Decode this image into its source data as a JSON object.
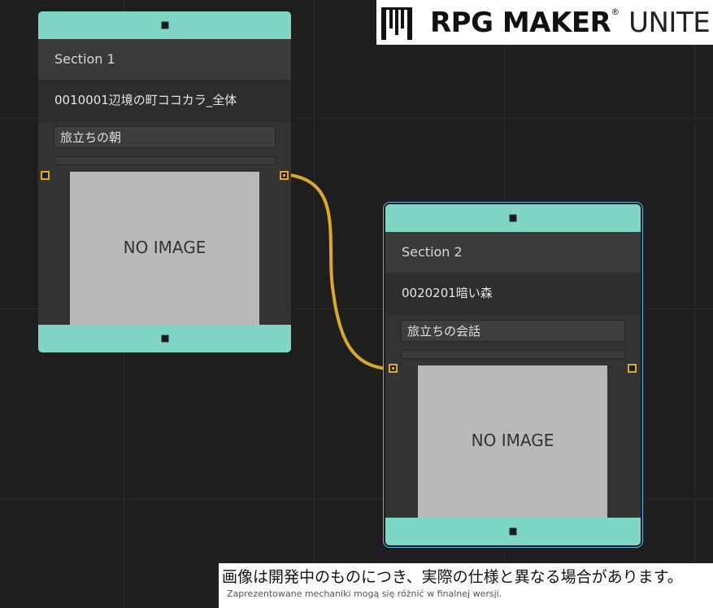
{
  "logo": {
    "brand": "RPG MAKER",
    "product": "UNITE"
  },
  "nodes": [
    {
      "section": "Section 1",
      "map": "0010001辺境の町ココカラ_全体",
      "event": "旅立ちの朝",
      "image_placeholder": "NO IMAGE",
      "selected": false
    },
    {
      "section": "Section 2",
      "map": "0020201暗い森",
      "event": "旅立ちの会話",
      "image_placeholder": "NO IMAGE",
      "selected": true
    }
  ],
  "connection": {
    "from": "Section 1",
    "to": "Section 2",
    "color": "#d8a92a"
  },
  "colors": {
    "background": "#1e1e1e",
    "node_accent": "#7fd6c4",
    "node_body": "#333333",
    "selection": "#5ab4e8"
  },
  "caption": {
    "japanese": "画像は開発中のものにつき、実際の仕様と異なる場合があります。",
    "polish": "Zaprezentowane mechaniki mogą się różnić w finalnej wersji."
  }
}
